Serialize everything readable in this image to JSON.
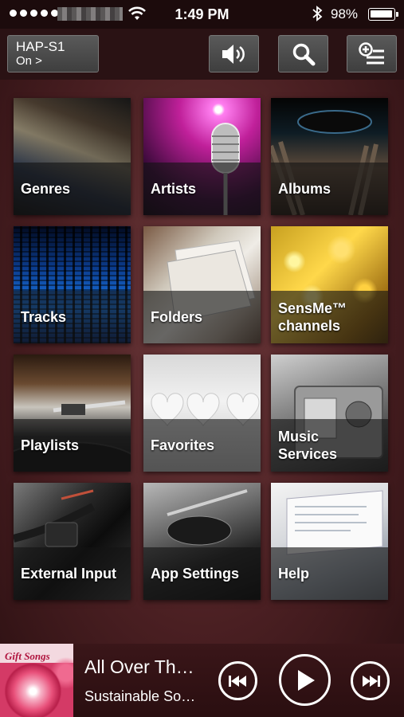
{
  "status_bar": {
    "time": "1:49 PM",
    "battery": "98%",
    "icons": [
      "signal-dots-icon",
      "wifi-icon",
      "bluetooth-icon",
      "battery-icon"
    ]
  },
  "header": {
    "device_name": "HAP-S1",
    "device_status": "On >",
    "buttons": [
      "volume-icon",
      "search-icon",
      "add-to-playlist-icon"
    ]
  },
  "menu": {
    "items": [
      {
        "label": "Genres"
      },
      {
        "label": "Artists"
      },
      {
        "label": "Albums"
      },
      {
        "label": "Tracks"
      },
      {
        "label": "Folders"
      },
      {
        "label": "SensMe™\nchannels"
      },
      {
        "label": "Playlists"
      },
      {
        "label": "Favorites"
      },
      {
        "label": "Music\nServices"
      },
      {
        "label": "External Input"
      },
      {
        "label": "App Settings"
      },
      {
        "label": "Help"
      }
    ]
  },
  "player": {
    "album_art_text": "Gift Songs",
    "track_title": "All Over Th…",
    "track_artist": "Sustainable So…",
    "controls": [
      "previous-icon",
      "play-icon",
      "next-icon"
    ]
  }
}
